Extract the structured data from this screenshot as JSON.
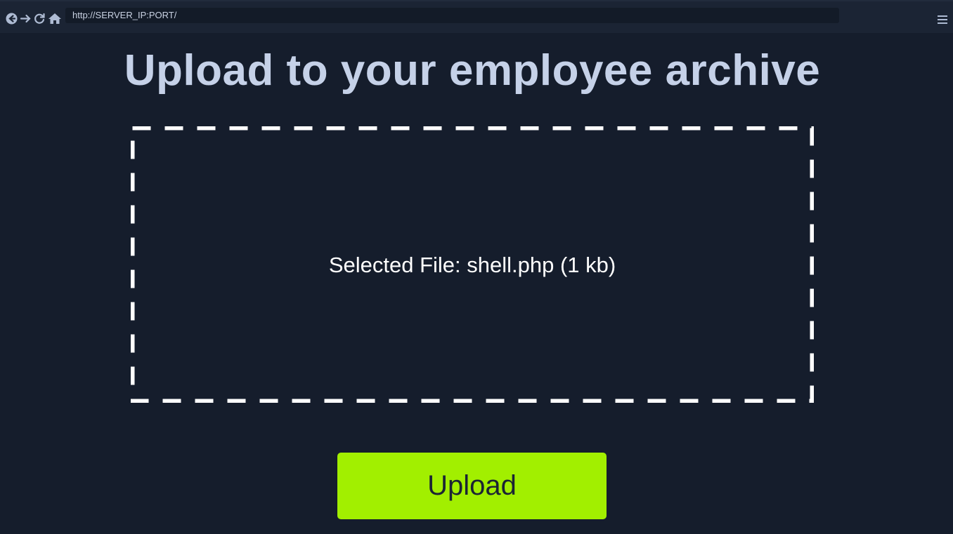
{
  "browser": {
    "url": "http://SERVER_IP:PORT/",
    "icons": [
      "back-icon",
      "forward-icon",
      "reload-icon",
      "home-icon",
      "menu-icon"
    ]
  },
  "page": {
    "title": "Upload to your employee archive",
    "selected_file_text": "Selected File: shell.php (1 kb)",
    "upload_label": "Upload"
  },
  "colors": {
    "background": "#151d2c",
    "title": "#c5d1e8",
    "accent": "#a2ef00",
    "dash": "#ffffff"
  }
}
